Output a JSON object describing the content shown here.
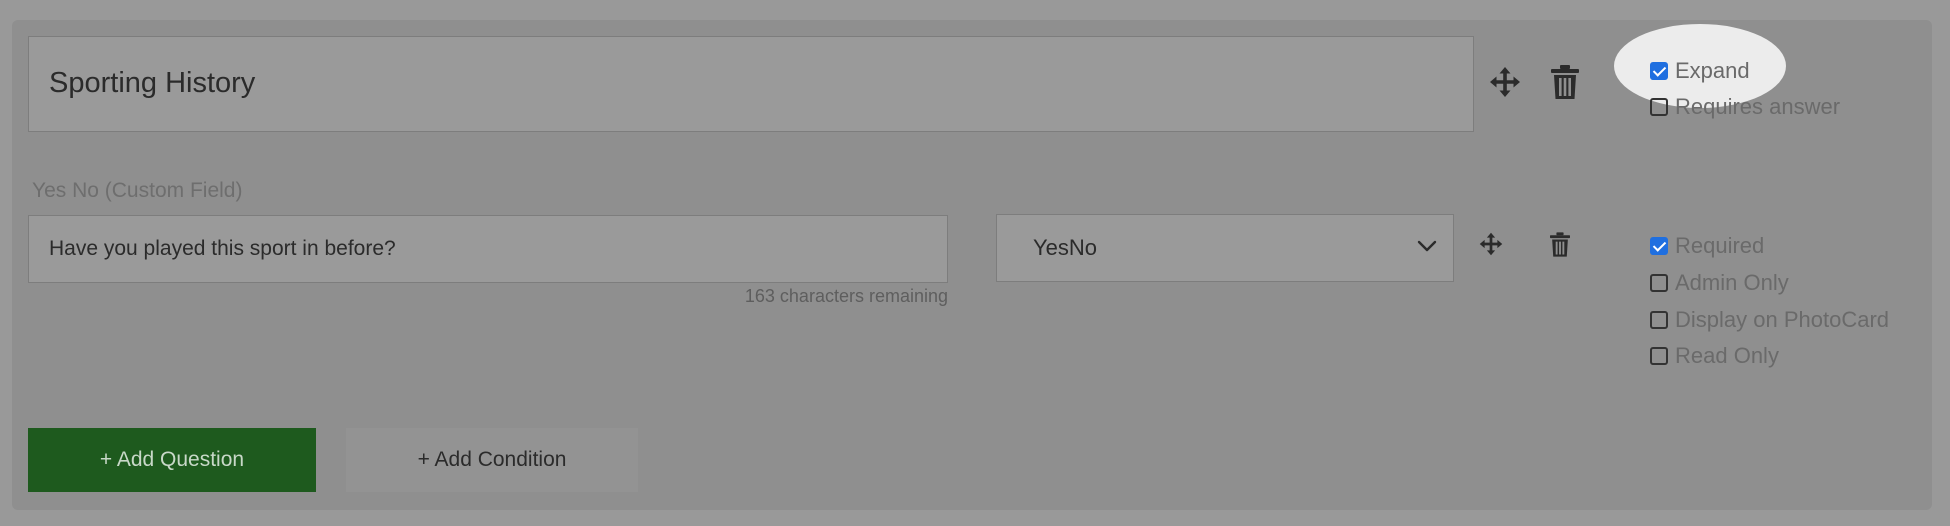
{
  "section": {
    "title": "Sporting History",
    "options": {
      "expand": {
        "label": "Expand",
        "checked": true
      },
      "requires_answer": {
        "label": "Requires answer",
        "checked": false
      }
    }
  },
  "question": {
    "field_type_label": "Yes No (Custom Field)",
    "text": "Have you played this sport in before?",
    "chars_remaining": "163 characters remaining",
    "type_select": {
      "selected": "YesNo"
    },
    "options": {
      "required": {
        "label": "Required",
        "checked": true
      },
      "admin_only": {
        "label": "Admin Only",
        "checked": false
      },
      "display_on_photocard": {
        "label": "Display on PhotoCard",
        "checked": false
      },
      "read_only": {
        "label": "Read Only",
        "checked": false
      }
    }
  },
  "actions": {
    "add_question": "+ Add Question",
    "add_condition": "+ Add Condition"
  },
  "icons": {
    "move": "move-icon",
    "delete": "trash-icon",
    "dropdown": "chevron-down-icon"
  },
  "colors": {
    "add_question_bg": "#1e5a1e",
    "checkbox_checked": "#1f6fe0"
  }
}
